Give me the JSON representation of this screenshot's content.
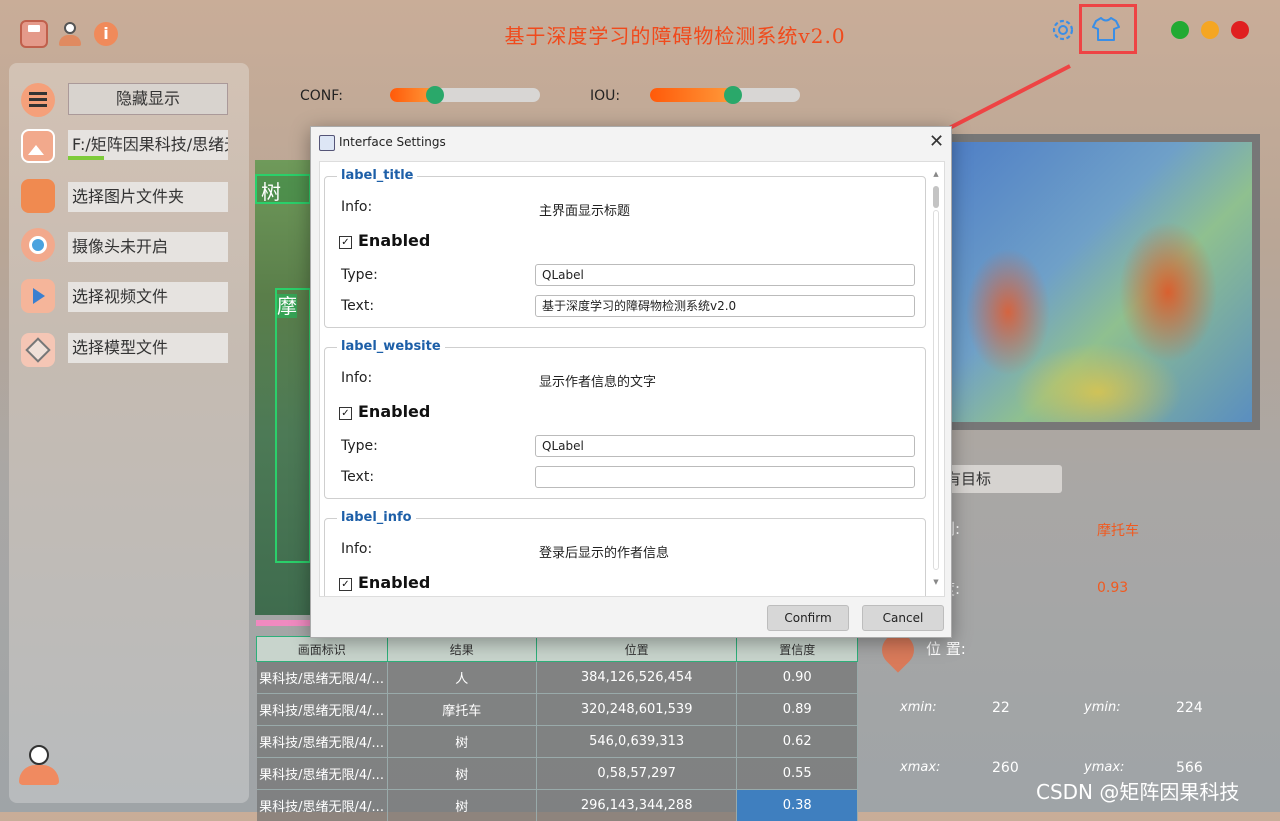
{
  "window": {
    "title": "基于深度学习的障碍物检测系统v2.0"
  },
  "sidebar": {
    "hide_button": "隐藏显示",
    "file_path": "F:/矩阵因果科技/思绪无",
    "items": [
      {
        "label": "选择图片文件夹",
        "icon": "folder-icon"
      },
      {
        "label": "摄像头未开启",
        "icon": "camera-icon"
      },
      {
        "label": "选择视频文件",
        "icon": "video-icon"
      },
      {
        "label": "选择模型文件",
        "icon": "model-icon"
      }
    ]
  },
  "sliders": {
    "conf_label": "CONF:",
    "conf_value": 0.3,
    "iou_label": "IOU:",
    "iou_value": 0.55
  },
  "left_image": {
    "labels": [
      "树",
      "摩"
    ]
  },
  "detail": {
    "target_select": "有目标",
    "type_label": "别:",
    "type_value": "摩托车",
    "conf_label": "度:",
    "conf_value": "0.93",
    "pos_label": "位 置:",
    "xmin_label": "xmin:",
    "xmin": "22",
    "ymin_label": "ymin:",
    "ymin": "224",
    "xmax_label": "xmax:",
    "xmax": "260",
    "ymax_label": "ymax:",
    "ymax": "566"
  },
  "table": {
    "headers": [
      "画面标识",
      "结果",
      "位置",
      "置信度"
    ],
    "rows": [
      [
        "果科技/思绪无限/4/...",
        "人",
        "384,126,526,454",
        "0.90"
      ],
      [
        "果科技/思绪无限/4/...",
        "摩托车",
        "320,248,601,539",
        "0.89"
      ],
      [
        "果科技/思绪无限/4/...",
        "树",
        "546,0,639,313",
        "0.62"
      ],
      [
        "果科技/思绪无限/4/...",
        "树",
        "0,58,57,297",
        "0.55"
      ],
      [
        "果科技/思绪无限/4/...",
        "树",
        "296,143,344,288",
        "0.38"
      ]
    ]
  },
  "dialog": {
    "title": "Interface Settings",
    "groups": [
      {
        "name": "label_title",
        "info_label": "Info:",
        "info": "主界面显示标题",
        "enabled_label": "Enabled",
        "type_label": "Type:",
        "type": "QLabel",
        "text_label": "Text:",
        "text": "基于深度学习的障碍物检测系统v2.0"
      },
      {
        "name": "label_website",
        "info_label": "Info:",
        "info": "显示作者信息的文字",
        "enabled_label": "Enabled",
        "type_label": "Type:",
        "type": "QLabel",
        "text_label": "Text:",
        "text": ""
      },
      {
        "name": "label_info",
        "info_label": "Info:",
        "info": "登录后显示的作者信息",
        "enabled_label": "Enabled"
      }
    ],
    "confirm": "Confirm",
    "cancel": "Cancel"
  },
  "watermark": "CSDN @矩阵因果科技",
  "colors": {
    "title": "#f04a1c",
    "accent": "#1d5fa8",
    "highlight_box": "#ee4444",
    "window_green": "#22aa33",
    "window_yellow": "#f5a623",
    "window_red": "#e02020"
  }
}
